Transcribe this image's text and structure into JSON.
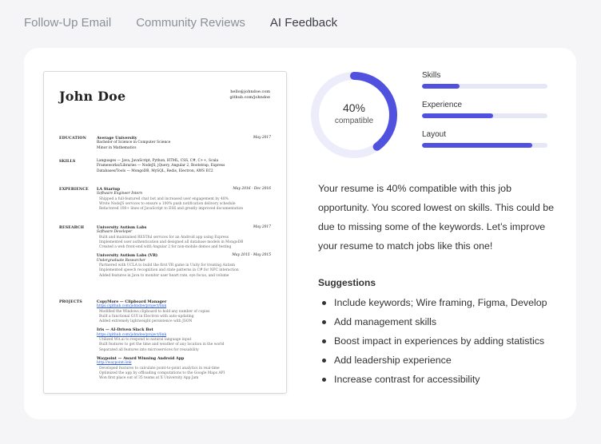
{
  "tabs": [
    "Follow-Up Email",
    "Community Reviews",
    "AI Feedback"
  ],
  "colors": {
    "accent": "#5151e0",
    "track": "#e6e7f5"
  },
  "resume": {
    "name": "John Doe",
    "email": "hello@johndoe.com",
    "github": "github.com/johndoe",
    "sections": {
      "education": "EDUCATION",
      "skills": "SKILLS",
      "experience": "EXPERIENCE",
      "research": "RESEARCH",
      "projects": "PROJECTS"
    },
    "edu": {
      "school": "Average University",
      "date": "May 2017",
      "line1": "Bachelor of Science in Computer Science",
      "line2": "Minor in Mathematics"
    },
    "skills": {
      "languages": "Languages — Java, JavaScript, Python, HTML, CSS, C#, C++, Scala",
      "frameworks": "Frameworks/Libraries — NodeJS, jQuery, Angular 2, Bootstrap, Express",
      "databases": "Databases/Tools — MongoDB, MySQL, Redis, Electron, AWS EC2"
    },
    "exp": {
      "company": "LA Startup",
      "date": "May 2016 - Dec 2016",
      "role": "Software Engineer Intern",
      "b1": "Shipped a full-featured chat bot and increased user engagement by 48%",
      "b2": "Wrote NodeJS services to ensure a 100% push notification delivery schedule",
      "b3": "Refactored 100+ lines of JavaScript to ES6 and greatly improved documentation"
    },
    "res1": {
      "org": "University Autism Labs",
      "date": "May 2017",
      "role": "Software Developer",
      "b1": "Built and maintained RESTful services for an Android app using Express",
      "b2": "Implemented user authentication and designed all database models in MongoDB",
      "b3": "Created a web front-end with Angular 2 for non-mobile demos and testing"
    },
    "res2": {
      "org": "University Autism Labs (VR)",
      "date": "May 2015 - May 2015",
      "role": "Undergraduate Researcher",
      "b1": "Partnered with UCLA to build the first VR game in Unity for treating Autism",
      "b2": "Implemented speech recognition and state patterns in C# for NPC interaction",
      "b3": "Added features in Java to monitor user heart rate, eye focus, and volume"
    },
    "proj1": {
      "title": "CopyMore — Clipboard Manager",
      "link": "https://github.com/johndoe/project/link",
      "b1": "Modified the Windows clipboard to hold any number of copies",
      "b2": "Built a functional GUI in Electron with auto-updating",
      "b3": "Added extremely lightweight persistence with JSON"
    },
    "proj2": {
      "title": "Iris — AI-Driven Slack Bot",
      "link": "https://github.com/johndoe/project/link",
      "b1": "Utilized Wit.ai to respond to natural language input",
      "b2": "Built features to get the time and weather of any location in the world",
      "b3": "Separated all features into microservices for reusability"
    },
    "proj3": {
      "title": "Waypoint — Award Winning Android App",
      "link": "http://waypoint.link",
      "b1": "Developed features to calculate point-to-point analytics in real-time",
      "b2": "Optimized the app by offloading computations to the Google Maps API",
      "b3": "Won first place out of 35 teams at X University App Jam"
    }
  },
  "score": {
    "percent": "40%",
    "percent_value": 40,
    "label": "compatible"
  },
  "metrics": [
    {
      "label": "Skills",
      "value": 0.3
    },
    {
      "label": "Experience",
      "value": 0.57
    },
    {
      "label": "Layout",
      "value": 0.88
    }
  ],
  "summary": "Your resume is 40% compatible with this job opportunity. You scored lowest on skills. This could be due to missing some of the keywords. Let’s improve your resume to match jobs like this one!",
  "suggestions_title": "Suggestions",
  "suggestions": [
    "Include keywords; Wire framing, Figma, Develop",
    "Add management skills",
    "Boost impact in experiences by adding statistics",
    "Add leadership experience",
    "Increase contrast for accessibility"
  ]
}
